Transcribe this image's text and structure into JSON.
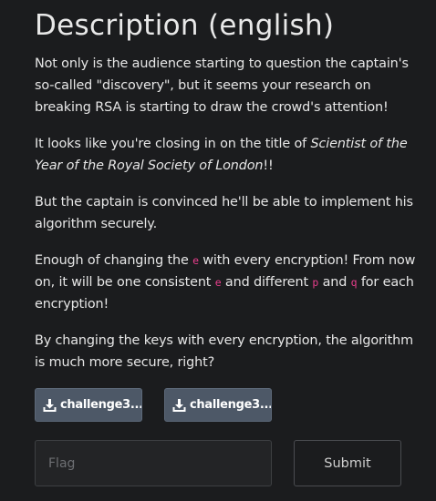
{
  "title": "Description (english)",
  "paragraphs": {
    "p1": "Not only is the audience starting to question the captain's so-called \"discovery\", but it seems your research on breaking RSA is starting to draw the crowd's attention!",
    "p2_before": "It looks like you're closing in on the title of ",
    "p2_em": "Scientist of the Year of the Royal Society of London",
    "p2_after": "!!",
    "p3": "But the captain is convinced he'll be able to implement his algorithm securely.",
    "p4_a": "Enough of changing the ",
    "p4_code1": "e",
    "p4_b": " with every encryption! From now on, it will be one consistent ",
    "p4_code2": "e",
    "p4_c": " and different ",
    "p4_code3": "p",
    "p4_d": " and ",
    "p4_code4": "q",
    "p4_e": " for each encryption!",
    "p5": "By changing the keys with every encryption, the algorithm is much more secure, right?"
  },
  "downloads": [
    {
      "label": "challenge3...",
      "icon": "download-icon"
    },
    {
      "label": "challenge3...",
      "icon": "download-icon"
    }
  ],
  "flag_input": {
    "placeholder": "Flag",
    "value": ""
  },
  "submit_label": "Submit",
  "colors": {
    "background": "#1b1c1e",
    "code": "#e83e8c",
    "download_button": "#4d5867"
  }
}
